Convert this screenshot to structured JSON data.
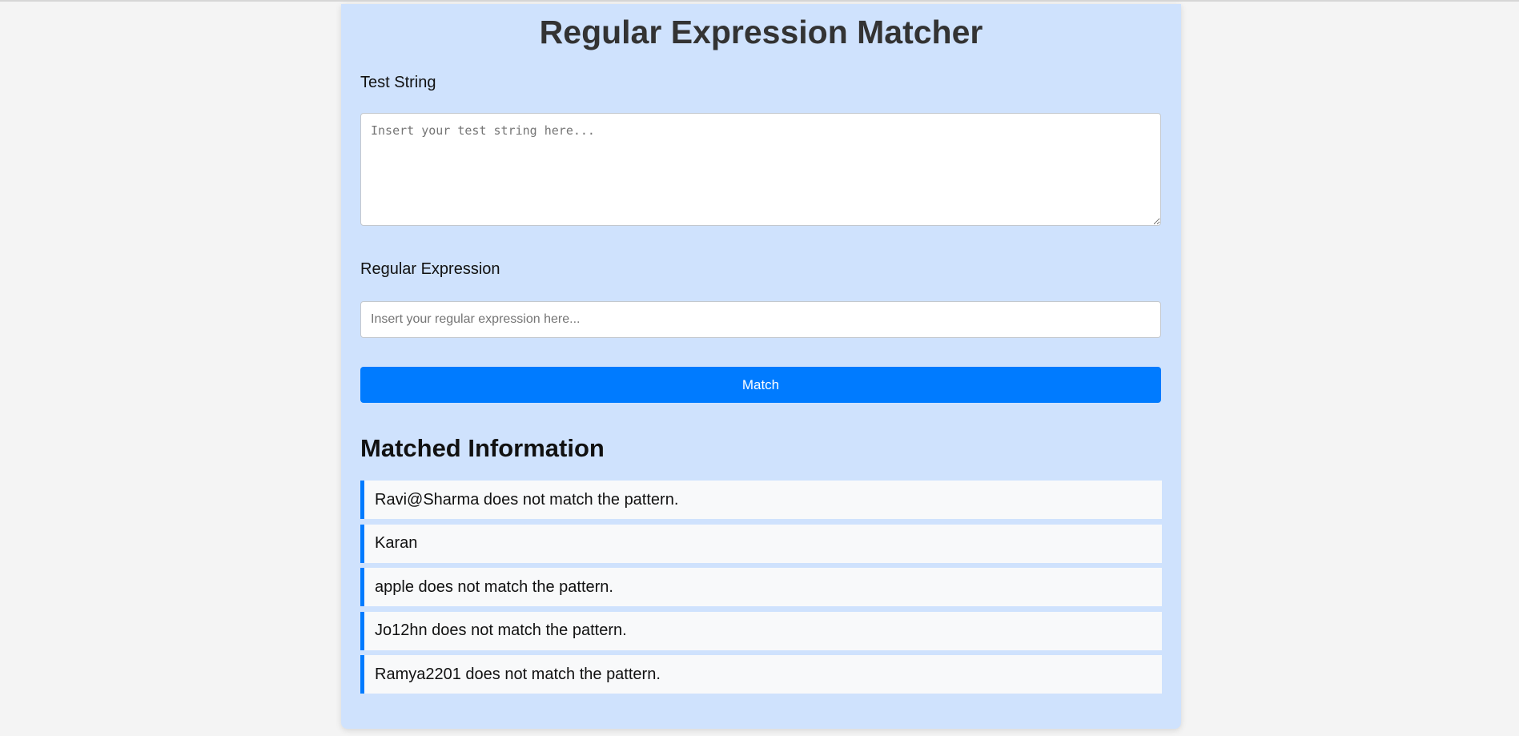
{
  "title": "Regular Expression Matcher",
  "test_string": {
    "label": "Test String",
    "value": "",
    "placeholder": "Insert your test string here..."
  },
  "regex": {
    "label": "Regular Expression",
    "value": "",
    "placeholder": "Insert your regular expression here..."
  },
  "match_button": "Match",
  "results": {
    "heading": "Matched Information",
    "items": [
      "Ravi@Sharma does not match the pattern.",
      "Karan",
      "apple does not match the pattern.",
      "Jo12hn does not match the pattern.",
      "Ramya2201 does not match the pattern."
    ]
  },
  "colors": {
    "accent": "#007bff",
    "panel": "#cfe2fd",
    "background": "#f4f4f4",
    "item": "#f8f9fa"
  }
}
